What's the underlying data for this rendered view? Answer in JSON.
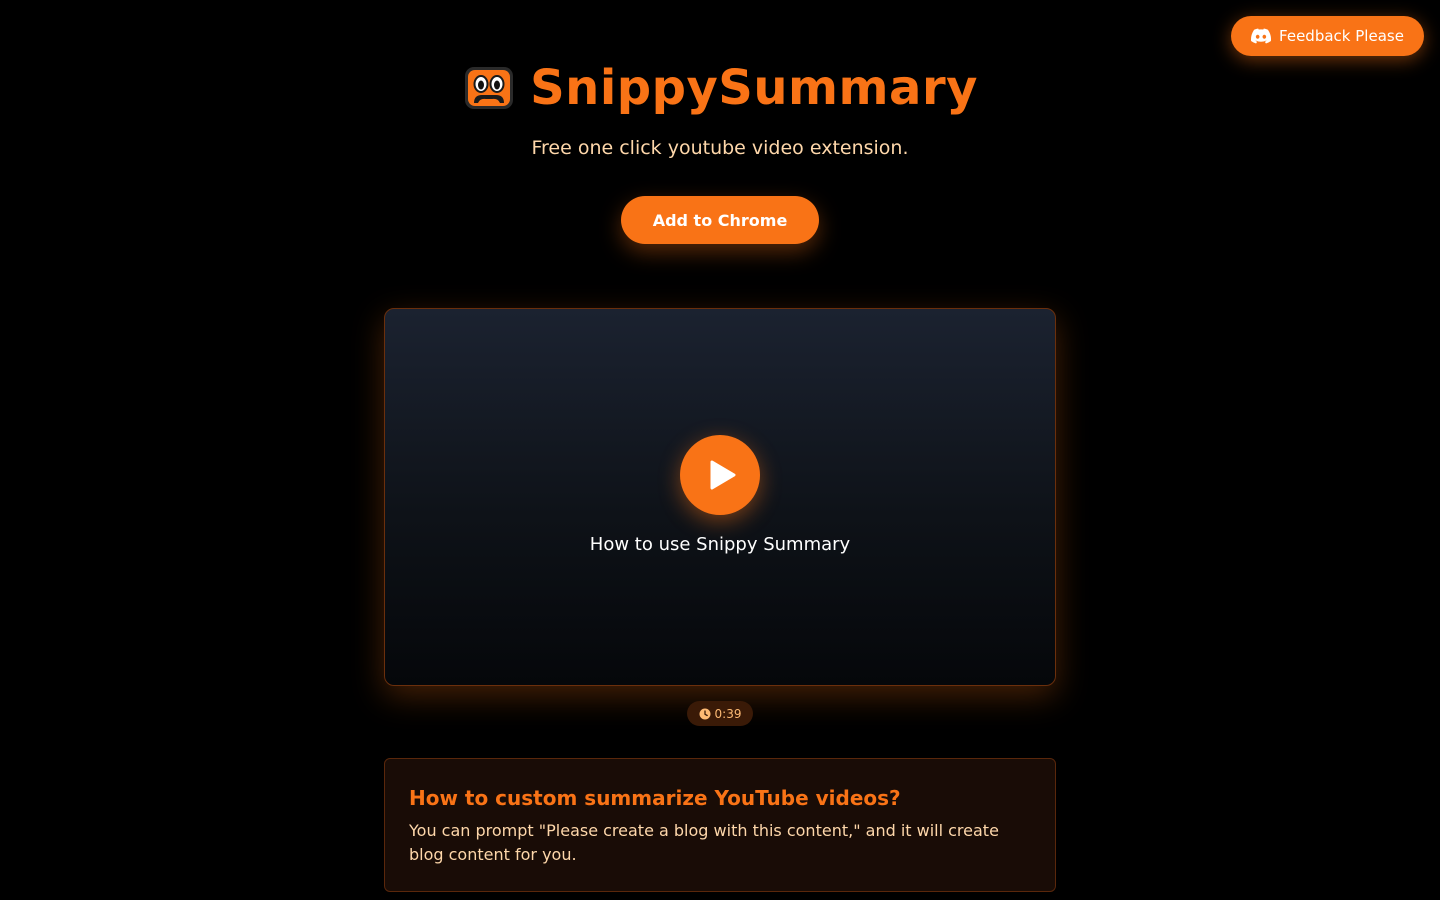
{
  "feedback": {
    "label": "Feedback Please",
    "icon": "discord-icon"
  },
  "header": {
    "logo_icon": "snippy-mascot-icon",
    "title": "SnippySummary",
    "subtitle": "Free one click youtube video extension."
  },
  "cta": {
    "label": "Add to Chrome"
  },
  "video": {
    "title": "How to use Snippy Summary",
    "duration": "0:39",
    "play_icon": "play-icon",
    "duration_icon": "clock-icon"
  },
  "faq": {
    "question": "How to custom summarize YouTube videos?",
    "answer": "You can prompt \"Please create a blog with this content,\" and it will create blog content for you."
  },
  "colors": {
    "accent": "#f97316",
    "background": "#000000",
    "soft_text": "#fed7aa",
    "card_bg": "#190c06"
  }
}
